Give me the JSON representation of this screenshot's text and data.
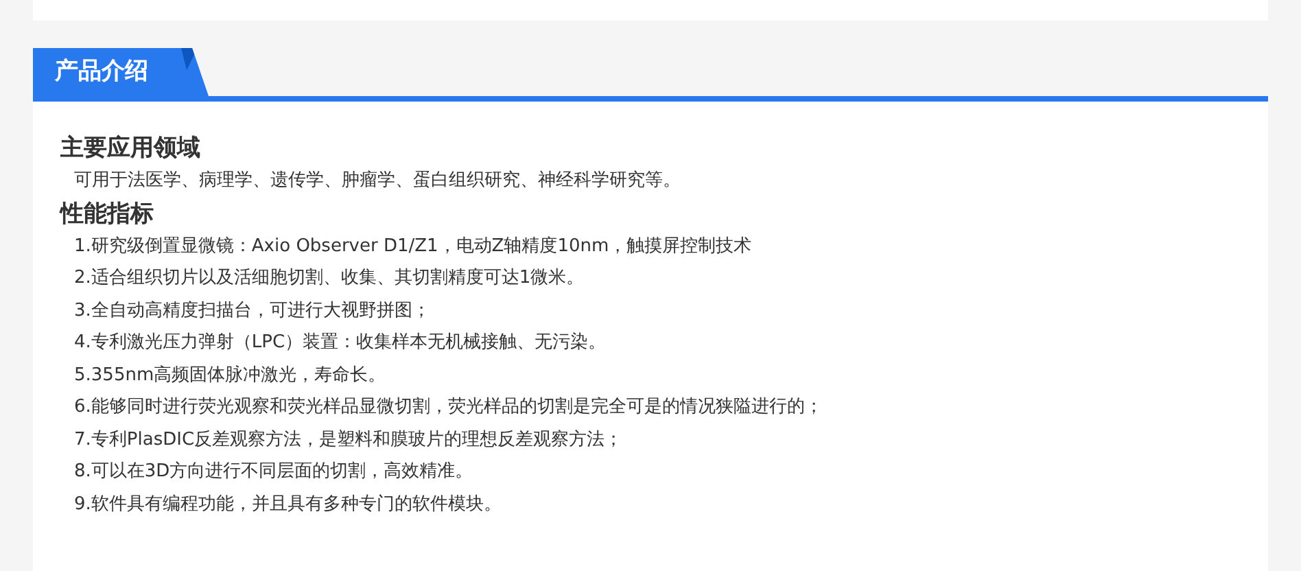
{
  "section_tab": {
    "label": "产品介绍"
  },
  "blocks": [
    {
      "heading": "主要应用领域",
      "lines": [
        "可用于法医学、病理学、遗传学、肿瘤学、蛋白组织研究、神经科学研究等。"
      ]
    },
    {
      "heading": "性能指标",
      "lines": [
        "1.研究级倒置显微镜：Axio Observer D1/Z1，电动Z轴精度10nm，触摸屏控制技术",
        "2.适合组织切片以及活细胞切割、收集、其切割精度可达1微米。",
        "3.全自动高精度扫描台，可进行大视野拼图；",
        "4.专利激光压力弹射（LPC）装置：收集样本无机械接触、无污染。",
        "5.355nm高频固体脉冲激光，寿命长。",
        "6.能够同时进行荧光观察和荧光样品显微切割，荧光样品的切割是完全可是的情况狭隘进行的；",
        "7.专利PlasDIC反差观察方法，是塑料和膜玻片的理想反差观察方法；",
        "8.可以在3D方向进行不同层面的切割，高效精准。",
        "9.软件具有编程功能，并且具有多种专门的软件模块。"
      ]
    }
  ]
}
